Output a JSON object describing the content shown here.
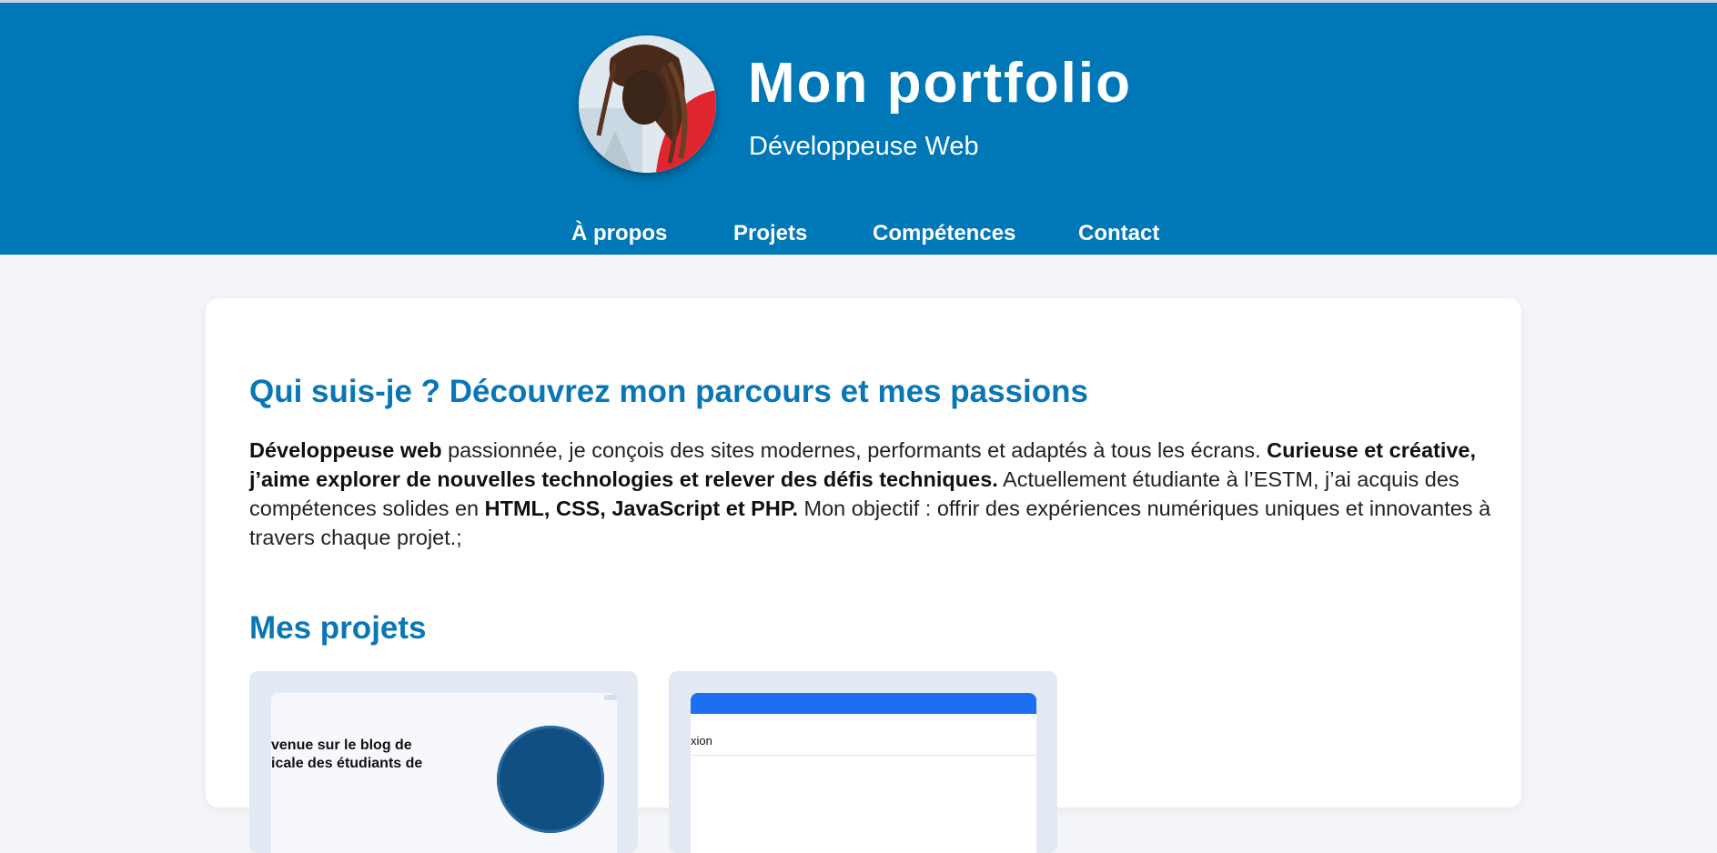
{
  "header": {
    "title": "Mon portfolio",
    "subtitle": "Développeuse Web"
  },
  "nav": {
    "items": [
      "À propos",
      "Projets",
      "Compétences",
      "Contact"
    ]
  },
  "about": {
    "title": "Qui suis-je ? Découvrez mon parcours et mes passions",
    "p1_bold": "Développeuse web",
    "p1": " passionnée, je conçois des sites modernes, performants et adaptés à tous les écrans. ",
    "p2_bold": "Curieuse et créative, j’aime explorer de nouvelles technologies et relever des défis techniques.",
    "p3": " Actuellement étudiante à l’ESTM, j’ai acquis des compétences solides en ",
    "p4_bold": "HTML, CSS, JavaScript et PHP.",
    "p5": " Mon objectif : offrir des expériences numériques uniques et innovantes à travers chaque projet.;"
  },
  "projects": {
    "title": "Mes projets",
    "card1_text_line1": "venue sur le blog de",
    "card1_text_line2": "icale des étudiants de",
    "card2_text": "xion"
  },
  "colors": {
    "brand": "#0077b6",
    "heading": "#0a77b5",
    "background": "#f3f5f9"
  }
}
